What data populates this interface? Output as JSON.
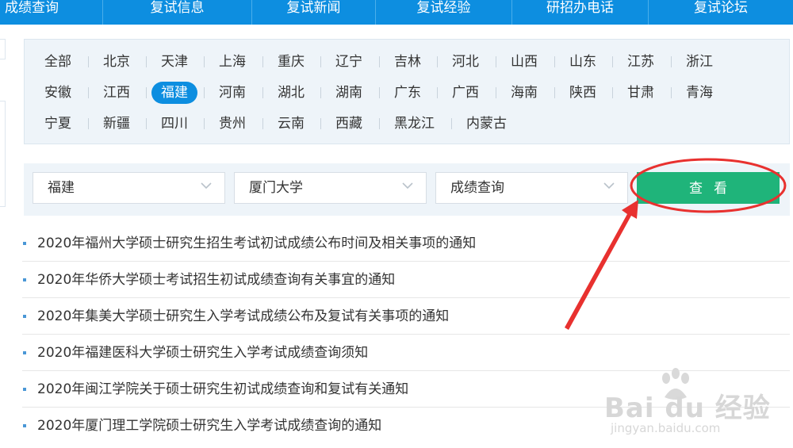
{
  "topnav": {
    "items": [
      "成绩查询",
      "复试信息",
      "复试新闻",
      "复试经验",
      "研招办电话",
      "复试论坛"
    ]
  },
  "provinces": {
    "items": [
      "全部",
      "北京",
      "天津",
      "上海",
      "重庆",
      "辽宁",
      "吉林",
      "河北",
      "山西",
      "山东",
      "江苏",
      "浙江",
      "安徽",
      "江西",
      "福建",
      "河南",
      "湖北",
      "湖南",
      "广东",
      "广西",
      "海南",
      "陕西",
      "甘肃",
      "青海",
      "宁夏",
      "新疆",
      "四川",
      "贵州",
      "云南",
      "西藏",
      "黑龙江",
      "内蒙古"
    ],
    "selected": "福建"
  },
  "search": {
    "province_value": "福建",
    "school_value": "厦门大学",
    "category_value": "成绩查询",
    "submit_label": "查看"
  },
  "news": {
    "items": [
      "2020年福州大学硕士研究生招生考试初试成绩公布时间及相关事项的通知",
      "2020年华侨大学硕士考试招生初试成绩查询有关事宜的通知",
      "2020年集美大学硕士研究生入学考试成绩公布及复试有关事项的通知",
      "2020年福建医科大学硕士研究生入学考试成绩查询须知",
      "2020年闽江学院关于硕士研究生初试成绩查询和复试有关通知",
      "2020年厦门理工学院硕士研究生入学考试成绩查询的通知"
    ]
  },
  "watermark": {
    "brand": "Bai du 经验",
    "url": "jingyan.baidu.com"
  },
  "colors": {
    "nav_blue": "#0d8ee0",
    "button_green": "#1fb47a",
    "annotation_red": "#e8312f"
  }
}
